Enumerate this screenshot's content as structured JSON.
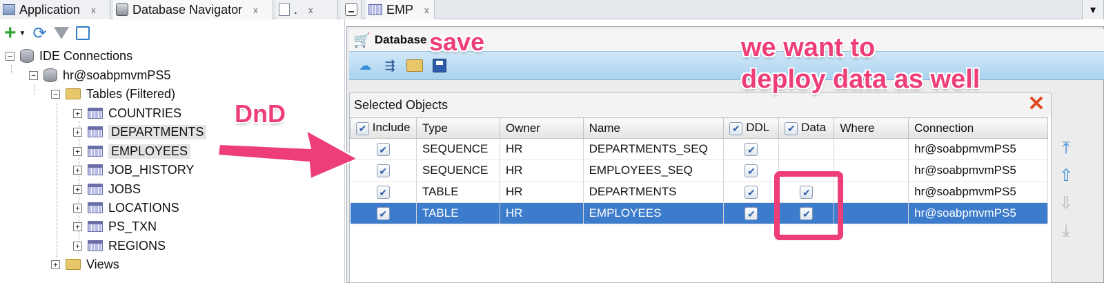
{
  "tabs": {
    "application": "Application",
    "database_navigator": "Database Navigator",
    "third_tab": ".",
    "close": "x",
    "emp_tab": "EMP"
  },
  "tree": {
    "ide_connections": "IDE Connections",
    "connection": "hr@soabpmvmPS5",
    "tables_folder": "Tables (Filtered)",
    "tables": [
      "COUNTRIES",
      "DEPARTMENTS",
      "EMPLOYEES",
      "JOB_HISTORY",
      "JOBS",
      "LOCATIONS",
      "PS_TXN",
      "REGIONS"
    ],
    "views": "Views"
  },
  "dialog": {
    "title": "Database",
    "selected_objects": "Selected Objects",
    "columns": {
      "include": "Include",
      "type": "Type",
      "owner": "Owner",
      "name": "Name",
      "ddl": "DDL",
      "data": "Data",
      "where": "Where",
      "connection": "Connection"
    },
    "rows": [
      {
        "type": "SEQUENCE",
        "owner": "HR",
        "name": "DEPARTMENTS_SEQ",
        "include": true,
        "ddl": true,
        "data": null,
        "connection": "hr@soabpmvmPS5"
      },
      {
        "type": "SEQUENCE",
        "owner": "HR",
        "name": "EMPLOYEES_SEQ",
        "include": true,
        "ddl": true,
        "data": null,
        "connection": "hr@soabpmvmPS5"
      },
      {
        "type": "TABLE",
        "owner": "HR",
        "name": "DEPARTMENTS",
        "include": true,
        "ddl": true,
        "data": true,
        "connection": "hr@soabpmvmPS5"
      },
      {
        "type": "TABLE",
        "owner": "HR",
        "name": "EMPLOYEES",
        "include": true,
        "ddl": true,
        "data": true,
        "connection": "hr@soabpmvmPS5"
      }
    ]
  },
  "annotations": {
    "save": "save",
    "dnd": "DnD",
    "deploy_line1": "we want to",
    "deploy_line2": "deploy data as well"
  },
  "colors": {
    "annotation": "#ee3e77",
    "selection": "#3d7ccc"
  }
}
